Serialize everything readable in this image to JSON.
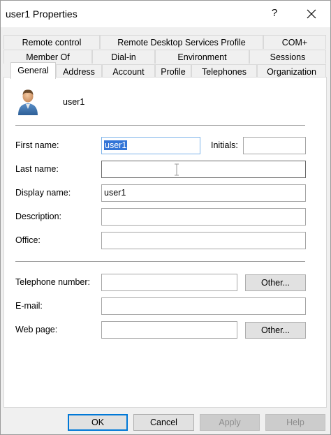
{
  "window": {
    "title": "user1 Properties",
    "help_glyph": "?"
  },
  "tabs": {
    "row1": [
      "Remote control",
      "Remote Desktop Services Profile",
      "COM+"
    ],
    "row2": [
      "Member Of",
      "Dial-in",
      "Environment",
      "Sessions"
    ],
    "row3": [
      "General",
      "Address",
      "Account",
      "Profile",
      "Telephones",
      "Organization"
    ],
    "active": "General"
  },
  "general": {
    "user_name": "user1",
    "first_name_label": "First name:",
    "first_name_value": "user1",
    "initials_label": "Initials:",
    "initials_value": "",
    "last_name_label": "Last name:",
    "last_name_value": "",
    "display_name_label": "Display name:",
    "display_name_value": "user1",
    "description_label": "Description:",
    "description_value": "",
    "office_label": "Office:",
    "office_value": "",
    "telephone_label": "Telephone number:",
    "telephone_value": "",
    "email_label": "E-mail:",
    "email_value": "",
    "webpage_label": "Web page:",
    "webpage_value": "",
    "other_label": "Other..."
  },
  "buttons": {
    "ok": "OK",
    "cancel": "Cancel",
    "apply": "Apply",
    "help": "Help"
  },
  "colors": {
    "selection": "#3375d7",
    "default_button_border": "#0078d7",
    "dialog_bg": "#f0f0f0"
  }
}
